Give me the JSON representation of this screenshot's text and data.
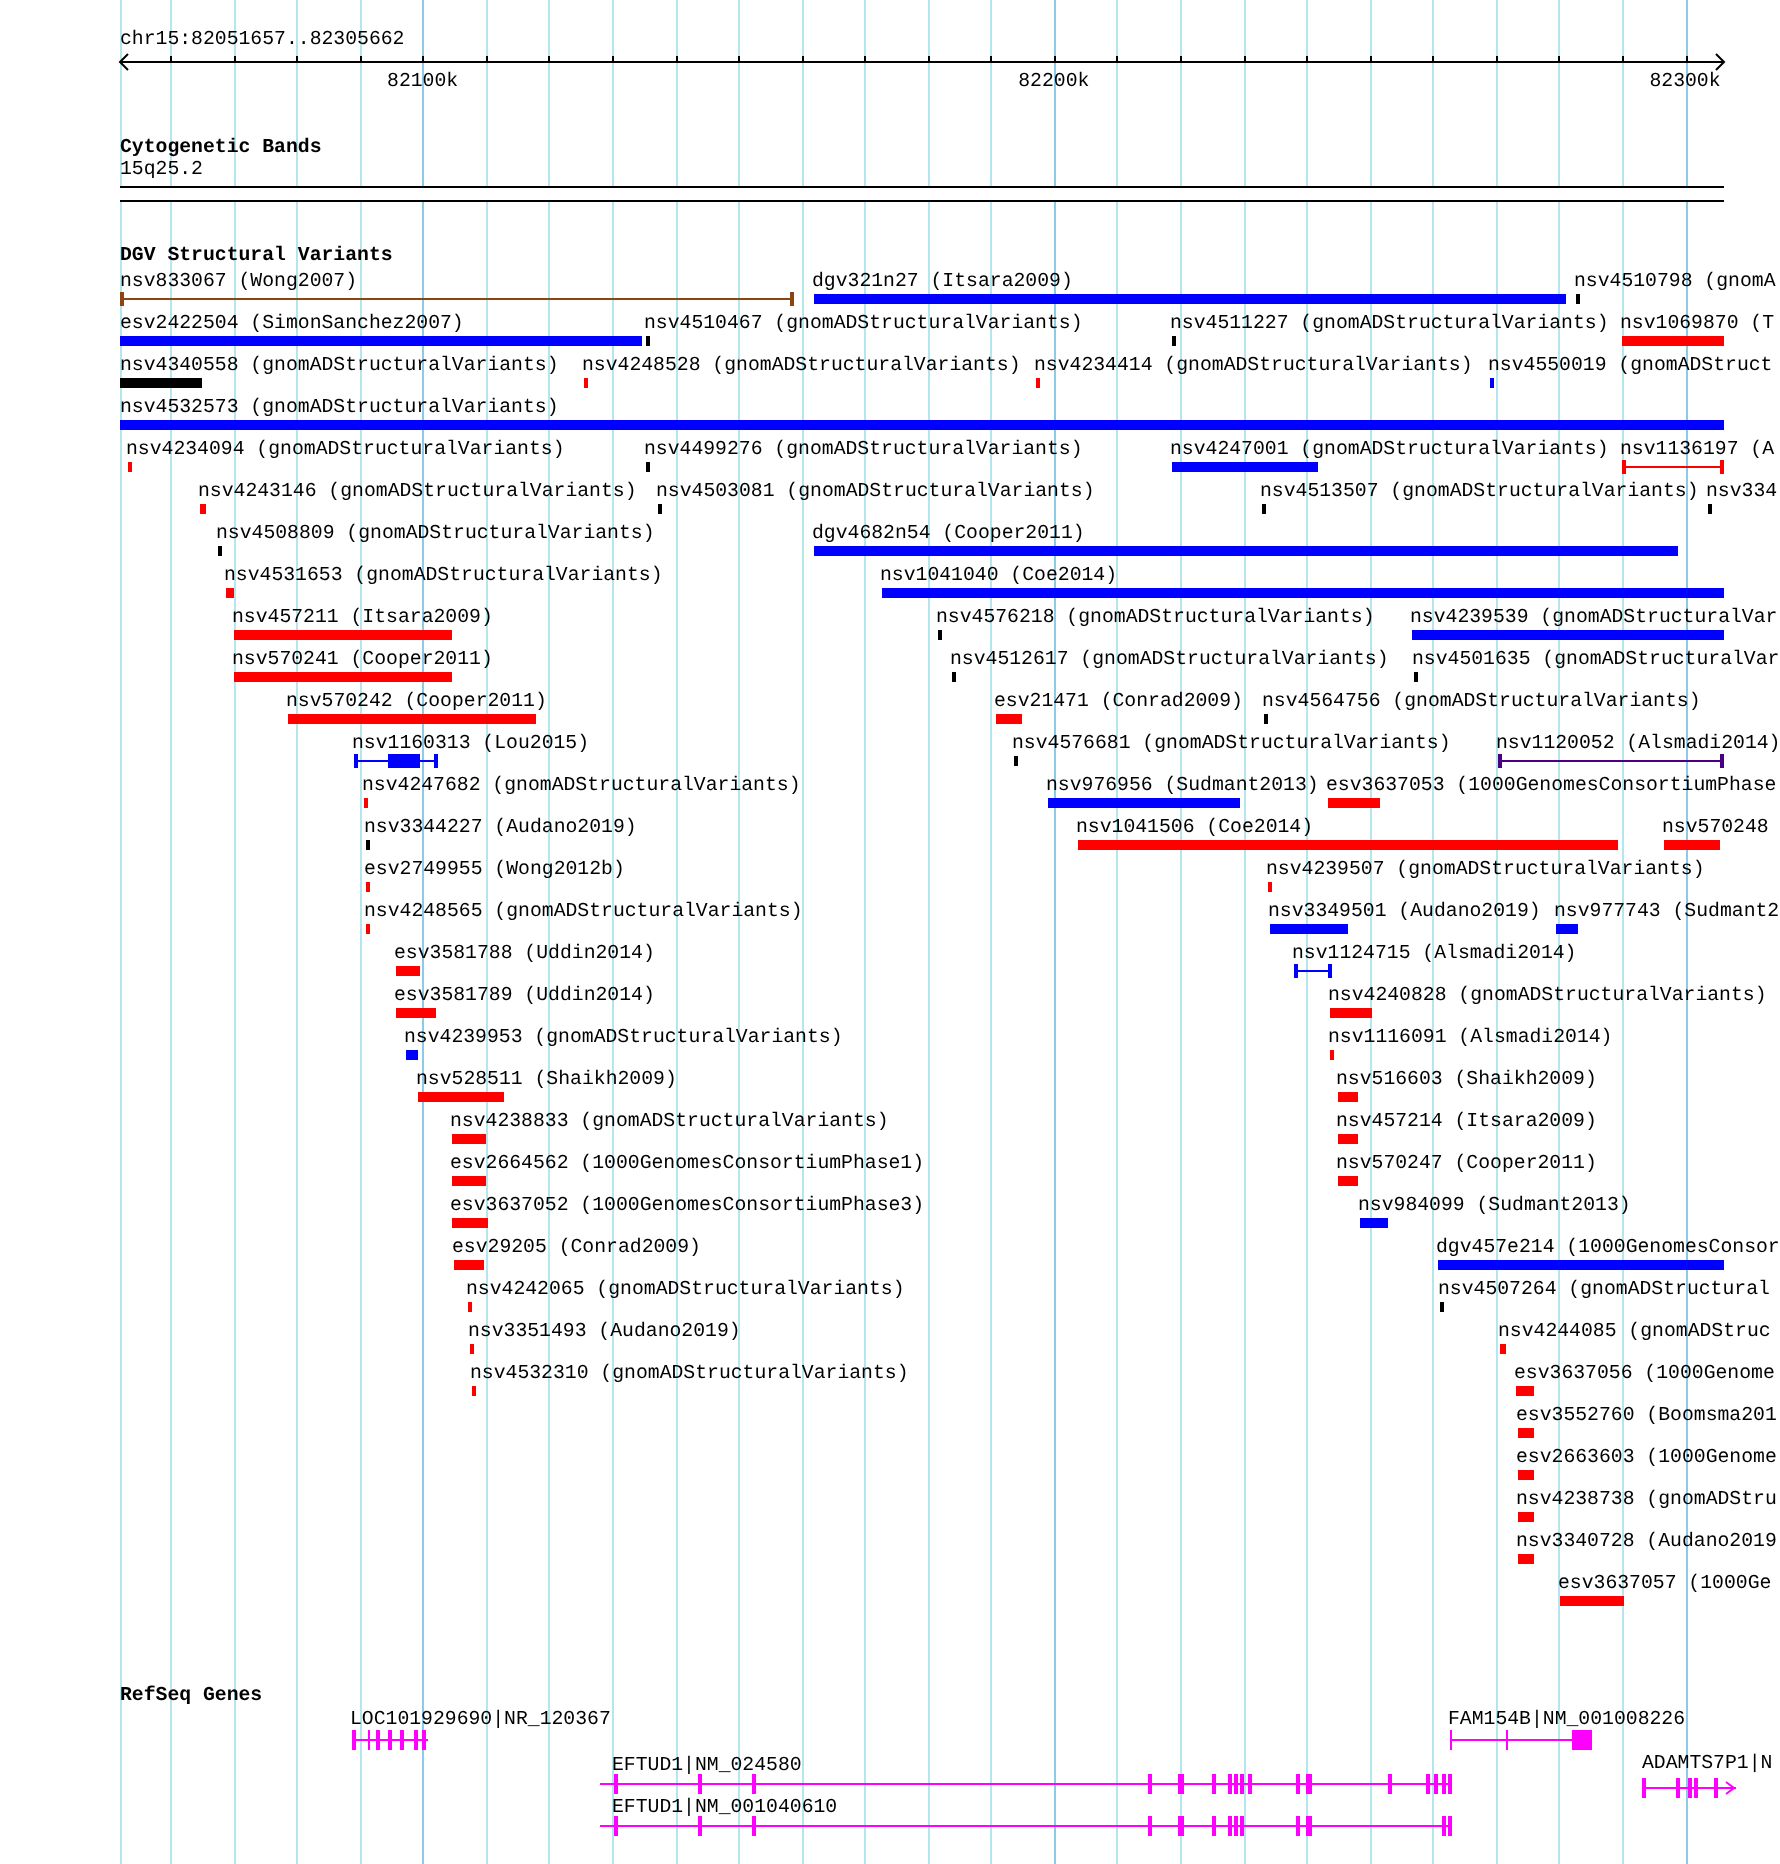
{
  "location": "chr15:82051657..82305662",
  "ruler_ticks": [
    "82100k",
    "82200k",
    "82300k"
  ],
  "cytogenetic_track": {
    "title": "Cytogenetic Bands",
    "band": "15q25.2"
  },
  "dgv_track": {
    "title": "DGV Structural Variants",
    "features": [
      {
        "label": "nsv833067 (Wong2007)",
        "kind": "line",
        "color": "#8b4513"
      },
      {
        "label": "dgv321n27 (Itsara2009)",
        "kind": "bar",
        "color": "#0000ff"
      },
      {
        "label": "nsv4510798 (gnomA",
        "kind": "bar",
        "color": "#000000"
      },
      {
        "label": "esv2422504 (SimonSanchez2007)",
        "kind": "bar",
        "color": "#0000ff"
      },
      {
        "label": "nsv4510467 (gnomADStructuralVariants)",
        "kind": "bar",
        "color": "#000000"
      },
      {
        "label": "nsv4511227 (gnomADStructuralVariants)",
        "kind": "bar",
        "color": "#000000"
      },
      {
        "label": "nsv1069870 (T",
        "kind": "bar",
        "color": "#ff0000"
      },
      {
        "label": "nsv4340558 (gnomADStructuralVariants)",
        "kind": "bar",
        "color": "#000000"
      },
      {
        "label": "nsv4248528 (gnomADStructuralVariants)",
        "kind": "bar",
        "color": "#ff0000"
      },
      {
        "label": "nsv4234414 (gnomADStructuralVariants)",
        "kind": "bar",
        "color": "#ff0000"
      },
      {
        "label": "nsv4550019 (gnomADStruct",
        "kind": "bar",
        "color": "#0000ff"
      },
      {
        "label": "nsv4532573 (gnomADStructuralVariants)",
        "kind": "bar",
        "color": "#0000ff"
      },
      {
        "label": "nsv4234094 (gnomADStructuralVariants)",
        "kind": "bar",
        "color": "#ff0000"
      },
      {
        "label": "nsv4499276 (gnomADStructuralVariants)",
        "kind": "bar",
        "color": "#000000"
      },
      {
        "label": "nsv4247001 (gnomADStructuralVariants)",
        "kind": "bar",
        "color": "#0000ff"
      },
      {
        "label": "nsv1136197 (A",
        "kind": "line",
        "color": "#ff0000"
      },
      {
        "label": "nsv4243146 (gnomADStructuralVariants)",
        "kind": "bar",
        "color": "#ff0000"
      },
      {
        "label": "nsv4503081 (gnomADStructuralVariants)",
        "kind": "bar",
        "color": "#000000"
      },
      {
        "label": "nsv4513507 (gnomADStructuralVariants)",
        "kind": "bar",
        "color": "#000000"
      },
      {
        "label": "nsv334",
        "kind": "bar",
        "color": "#000000"
      },
      {
        "label": "nsv4508809 (gnomADStructuralVariants)",
        "kind": "bar",
        "color": "#000000"
      },
      {
        "label": "dgv4682n54 (Cooper2011)",
        "kind": "bar",
        "color": "#0000ff"
      },
      {
        "label": "nsv4531653 (gnomADStructuralVariants)",
        "kind": "bar",
        "color": "#ff0000"
      },
      {
        "label": "nsv1041040 (Coe2014)",
        "kind": "bar",
        "color": "#0000ff"
      },
      {
        "label": "nsv457211 (Itsara2009)",
        "kind": "bar",
        "color": "#ff0000"
      },
      {
        "label": "nsv4576218 (gnomADStructuralVariants)",
        "kind": "bar",
        "color": "#000000"
      },
      {
        "label": "nsv4239539 (gnomADStructuralVar",
        "kind": "bar",
        "color": "#0000ff"
      },
      {
        "label": "nsv570241 (Cooper2011)",
        "kind": "bar",
        "color": "#ff0000"
      },
      {
        "label": "nsv4512617 (gnomADStructuralVariants)",
        "kind": "bar",
        "color": "#000000"
      },
      {
        "label": "nsv4501635 (gnomADStructuralVar",
        "kind": "bar",
        "color": "#000000"
      },
      {
        "label": "nsv570242 (Cooper2011)",
        "kind": "bar",
        "color": "#ff0000"
      },
      {
        "label": "esv21471 (Conrad2009)",
        "kind": "bar",
        "color": "#ff0000"
      },
      {
        "label": "nsv4564756 (gnomADStructuralVariants)",
        "kind": "bar",
        "color": "#000000"
      },
      {
        "label": "nsv1160313 (Lou2015)",
        "kind": "gapped",
        "color": "#0000ff"
      },
      {
        "label": "nsv4576681 (gnomADStructuralVariants)",
        "kind": "bar",
        "color": "#000000"
      },
      {
        "label": "nsv1120052 (Alsmadi2014)",
        "kind": "line",
        "color": "#4b0082"
      },
      {
        "label": "nsv4247682 (gnomADStructuralVariants)",
        "kind": "bar",
        "color": "#ff0000"
      },
      {
        "label": "nsv976956 (Sudmant2013)",
        "kind": "bar",
        "color": "#0000ff"
      },
      {
        "label": "esv3637053 (1000GenomesConsortiumPhase",
        "kind": "bar",
        "color": "#ff0000"
      },
      {
        "label": "nsv3344227 (Audano2019)",
        "kind": "bar",
        "color": "#000000"
      },
      {
        "label": "nsv1041506 (Coe2014)",
        "kind": "bar",
        "color": "#ff0000"
      },
      {
        "label": "nsv570248",
        "kind": "bar",
        "color": "#ff0000"
      },
      {
        "label": "esv2749955 (Wong2012b)",
        "kind": "bar",
        "color": "#ff0000"
      },
      {
        "label": "nsv4239507 (gnomADStructuralVariants)",
        "kind": "bar",
        "color": "#ff0000"
      },
      {
        "label": "nsv4248565 (gnomADStructuralVariants)",
        "kind": "bar",
        "color": "#ff0000"
      },
      {
        "label": "nsv3349501 (Audano2019)",
        "kind": "bar",
        "color": "#0000ff"
      },
      {
        "label": "nsv977743 (Sudmant2",
        "kind": "bar",
        "color": "#0000ff"
      },
      {
        "label": "esv3581788 (Uddin2014)",
        "kind": "bar",
        "color": "#ff0000"
      },
      {
        "label": "nsv1124715 (Alsmadi2014)",
        "kind": "line",
        "color": "#0000ff"
      },
      {
        "label": "esv3581789 (Uddin2014)",
        "kind": "bar",
        "color": "#ff0000"
      },
      {
        "label": "nsv4240828 (gnomADStructuralVariants)",
        "kind": "bar",
        "color": "#ff0000"
      },
      {
        "label": "nsv4239953 (gnomADStructuralVariants)",
        "kind": "bar",
        "color": "#0000ff"
      },
      {
        "label": "nsv1116091 (Alsmadi2014)",
        "kind": "bar",
        "color": "#ff0000"
      },
      {
        "label": "nsv528511 (Shaikh2009)",
        "kind": "bar",
        "color": "#ff0000"
      },
      {
        "label": "nsv516603 (Shaikh2009)",
        "kind": "bar",
        "color": "#ff0000"
      },
      {
        "label": "nsv4238833 (gnomADStructuralVariants)",
        "kind": "bar",
        "color": "#ff0000"
      },
      {
        "label": "nsv457214 (Itsara2009)",
        "kind": "bar",
        "color": "#ff0000"
      },
      {
        "label": "esv2664562 (1000GenomesConsortiumPhase1)",
        "kind": "bar",
        "color": "#ff0000"
      },
      {
        "label": "nsv570247 (Cooper2011)",
        "kind": "bar",
        "color": "#ff0000"
      },
      {
        "label": "esv3637052 (1000GenomesConsortiumPhase3)",
        "kind": "bar",
        "color": "#ff0000"
      },
      {
        "label": "nsv984099 (Sudmant2013)",
        "kind": "bar",
        "color": "#0000ff"
      },
      {
        "label": "esv29205 (Conrad2009)",
        "kind": "bar",
        "color": "#ff0000"
      },
      {
        "label": "dgv457e214 (1000GenomesConsor",
        "kind": "bar",
        "color": "#0000ff"
      },
      {
        "label": "nsv4242065 (gnomADStructuralVariants)",
        "kind": "bar",
        "color": "#ff0000"
      },
      {
        "label": "nsv4507264 (gnomADStructural",
        "kind": "bar",
        "color": "#000000"
      },
      {
        "label": "nsv3351493 (Audano2019)",
        "kind": "bar",
        "color": "#ff0000"
      },
      {
        "label": "nsv4244085 (gnomADStruc",
        "kind": "bar",
        "color": "#ff0000"
      },
      {
        "label": "nsv4532310 (gnomADStructuralVariants)",
        "kind": "bar",
        "color": "#ff0000"
      },
      {
        "label": "esv3637056 (1000Genome",
        "kind": "bar",
        "color": "#ff0000"
      },
      {
        "label": "esv3552760 (Boomsma201",
        "kind": "bar",
        "color": "#ff0000"
      },
      {
        "label": "esv2663603 (1000Genome",
        "kind": "bar",
        "color": "#ff0000"
      },
      {
        "label": "nsv4238738 (gnomADStru",
        "kind": "bar",
        "color": "#ff0000"
      },
      {
        "label": "nsv3340728 (Audano2019",
        "kind": "bar",
        "color": "#ff0000"
      },
      {
        "label": "esv3637057 (1000Ge",
        "kind": "bar",
        "color": "#ff0000"
      }
    ]
  },
  "refseq_track": {
    "title": "RefSeq Genes",
    "genes": [
      {
        "label": "LOC101929690|NR_120367"
      },
      {
        "label": "FAM154B|NM_001008226"
      },
      {
        "label": "EFTUD1|NM_024580"
      },
      {
        "label": "ADAMTS7P1|N"
      },
      {
        "label": "EFTUD1|NM_001040610"
      }
    ]
  }
}
